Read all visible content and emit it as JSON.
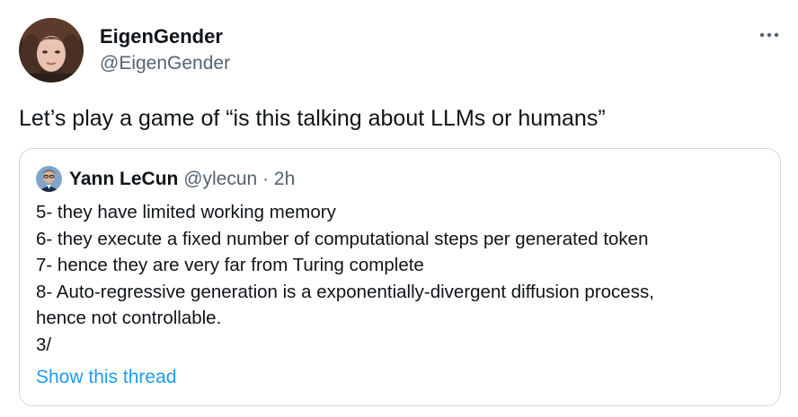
{
  "author": {
    "name": "EigenGender",
    "handle": "@EigenGender"
  },
  "tweet": {
    "text": "Let’s play a game of “is this talking about LLMs or humans”"
  },
  "icons": {
    "more": "more-horizontal-icon"
  },
  "quote": {
    "name": "Yann LeCun",
    "handle": "@ylecun",
    "separator": "·",
    "time": "2h",
    "lines": [
      "5- they have limited working memory",
      "6- they execute a fixed number of computational steps per generated token",
      "7- hence they are very far from Turing complete",
      "8- Auto-regressive generation is a exponentially-divergent diffusion process,",
      "hence not controllable.",
      "3/"
    ],
    "show_thread": "Show this thread"
  },
  "colors": {
    "text_primary": "#0f1419",
    "text_secondary": "#536471",
    "link": "#1d9bf0",
    "border": "#cfd9de"
  }
}
